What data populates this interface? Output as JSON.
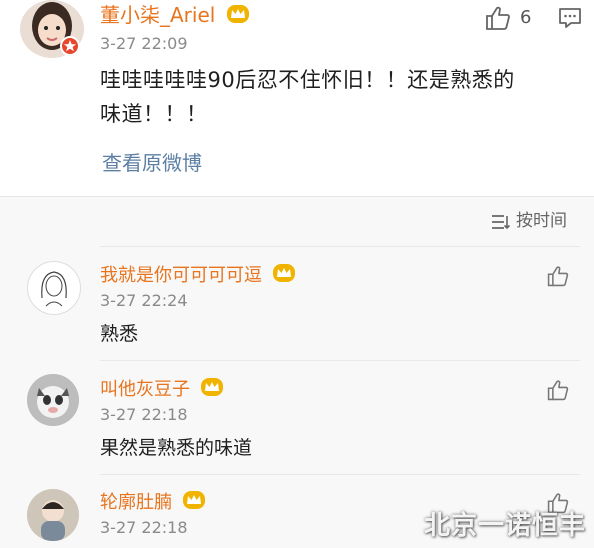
{
  "post": {
    "username": "董小柒_Ariel",
    "time": "3-27 22:09",
    "like_count": "6",
    "text_line1": "哇哇哇哇哇90后忍不住怀旧！！还是熟悉的",
    "text_line2": "味道！！！",
    "view_original": "查看原微博"
  },
  "sort": {
    "label": "按时间",
    "icon": "sort-icon"
  },
  "comments": [
    {
      "username": "我就是你可可可可逗",
      "time": "3-27 22:24",
      "text": "熟悉"
    },
    {
      "username": "叫他灰豆子",
      "time": "3-27 22:18",
      "text": "果然是熟悉的味道"
    },
    {
      "username": "轮廓肚腩",
      "time": "3-27 22:18",
      "text": ""
    }
  ],
  "watermark": "北京一诺恒丰",
  "colors": {
    "username": "#e8741e",
    "link": "#5c7fa3",
    "time": "#8a8a8a",
    "crown": "#f0b400"
  }
}
